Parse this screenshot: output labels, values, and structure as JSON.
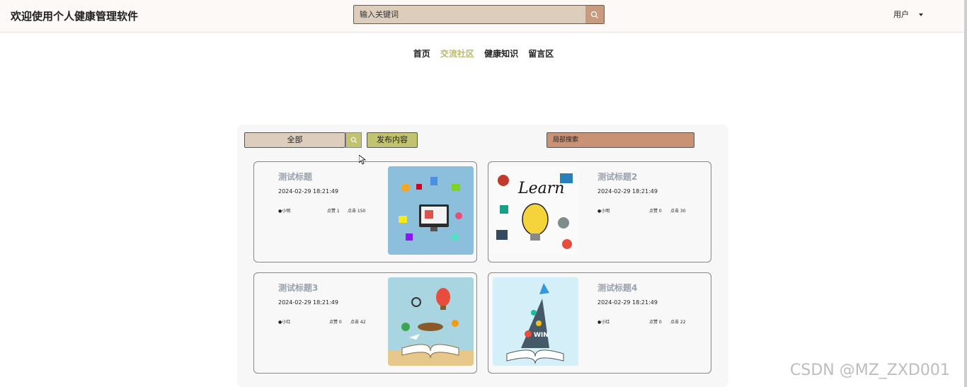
{
  "header": {
    "app_title": "欢迎使用个人健康管理软件",
    "search_placeholder": "输入关键词",
    "user_label": "用户"
  },
  "nav": {
    "items": [
      {
        "label": "首页",
        "active": false
      },
      {
        "label": "交流社区",
        "active": true
      },
      {
        "label": "健康知识",
        "active": false
      },
      {
        "label": "留言区",
        "active": false
      }
    ]
  },
  "toolbar": {
    "filter_value": "全部",
    "publish_label": "发布内容",
    "local_search_placeholder": "局部搜索"
  },
  "posts": [
    {
      "title": "测试标题",
      "time": "2024-02-29 18:21:49",
      "author": "小明",
      "likes": "点赞 1",
      "clicks": "点击 150",
      "image": "computer-infographic"
    },
    {
      "title": "测试标题2",
      "time": "2024-02-29 18:21:49",
      "author": "小明",
      "likes": "点赞 0",
      "clicks": "点击 30",
      "image": "learn-lightbulb"
    },
    {
      "title": "测试标题3",
      "time": "2024-02-29 18:21:49",
      "author": "小红",
      "likes": "点赞 0",
      "clicks": "点击 42",
      "image": "open-book-travel"
    },
    {
      "title": "测试标题4",
      "time": "2024-02-29 18:21:49",
      "author": "小红",
      "likes": "点赞 0",
      "clicks": "点击 22",
      "image": "open-book-rocket"
    }
  ],
  "watermark": "CSDN @MZ_ZXD001",
  "colors": {
    "active_nav": "#b9b86e",
    "search_box": "#dccdbd",
    "search_button": "#c89a7f",
    "publish_button": "#c1c36f",
    "local_search": "#c99274",
    "card_title": "#9aa3ad"
  }
}
